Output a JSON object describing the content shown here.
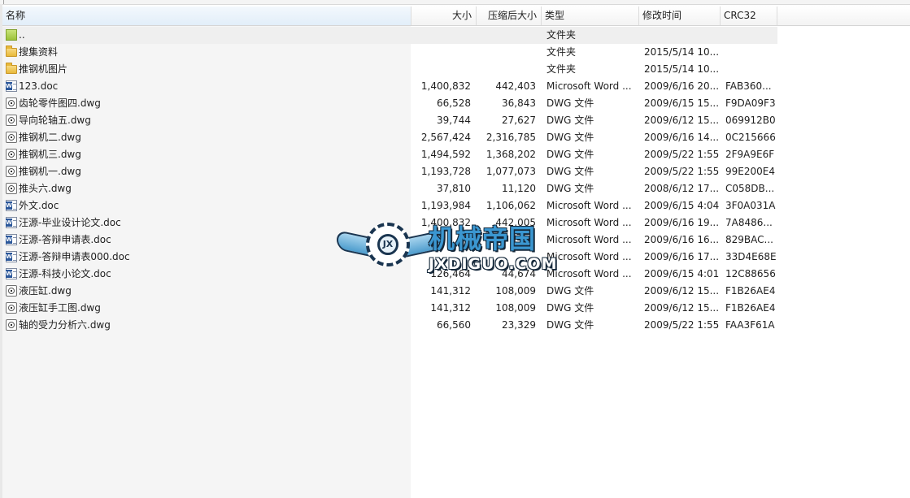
{
  "columns": {
    "name": "名称",
    "size": "大小",
    "compressed": "压缩后大小",
    "type": "类型",
    "modified": "修改时间",
    "crc": "CRC32"
  },
  "rows": [
    {
      "name": "..",
      "size": "",
      "compressed": "",
      "type": "文件夹",
      "modified": "",
      "crc": "",
      "icon": "folder-up-icon"
    },
    {
      "name": "搜集资料",
      "size": "",
      "compressed": "",
      "type": "文件夹",
      "modified": "2015/5/14 10...",
      "crc": "",
      "icon": "folder-icon"
    },
    {
      "name": "推钢机图片",
      "size": "",
      "compressed": "",
      "type": "文件夹",
      "modified": "2015/5/14 10...",
      "crc": "",
      "icon": "folder-icon"
    },
    {
      "name": "123.doc",
      "size": "1,400,832",
      "compressed": "442,403",
      "type": "Microsoft Word ...",
      "modified": "2009/6/16 20...",
      "crc": "FAB360...",
      "icon": "word-doc-icon"
    },
    {
      "name": "齿轮零件图四.dwg",
      "size": "66,528",
      "compressed": "36,843",
      "type": "DWG 文件",
      "modified": "2009/6/15 15...",
      "crc": "F9DA09F3",
      "icon": "dwg-file-icon"
    },
    {
      "name": "导向轮轴五.dwg",
      "size": "39,744",
      "compressed": "27,627",
      "type": "DWG 文件",
      "modified": "2009/6/12 15...",
      "crc": "069912B0",
      "icon": "dwg-file-icon"
    },
    {
      "name": "推钢机二.dwg",
      "size": "2,567,424",
      "compressed": "2,316,785",
      "type": "DWG 文件",
      "modified": "2009/6/16 14...",
      "crc": "0C215666",
      "icon": "dwg-file-icon"
    },
    {
      "name": "推钢机三.dwg",
      "size": "1,494,592",
      "compressed": "1,368,202",
      "type": "DWG 文件",
      "modified": "2009/5/22 1:55",
      "crc": "2F9A9E6F",
      "icon": "dwg-file-icon"
    },
    {
      "name": "推钢机一.dwg",
      "size": "1,193,728",
      "compressed": "1,077,073",
      "type": "DWG 文件",
      "modified": "2009/5/22 1:55",
      "crc": "99E200E4",
      "icon": "dwg-file-icon"
    },
    {
      "name": "推头六.dwg",
      "size": "37,810",
      "compressed": "11,120",
      "type": "DWG 文件",
      "modified": "2008/6/12 17...",
      "crc": "C058DB...",
      "icon": "dwg-file-icon"
    },
    {
      "name": "外文.doc",
      "size": "1,193,984",
      "compressed": "1,106,062",
      "type": "Microsoft Word ...",
      "modified": "2009/6/15 4:04",
      "crc": "3F0A031A",
      "icon": "word-doc-icon"
    },
    {
      "name": "汪源-毕业设计论文.doc",
      "size": "1,400,832",
      "compressed": "442,005",
      "type": "Microsoft Word ...",
      "modified": "2009/6/16 19...",
      "crc": "7A8486...",
      "icon": "word-doc-icon"
    },
    {
      "name": "汪源-答辩申请表.doc",
      "size": "",
      "compressed": "",
      "type": "Microsoft Word ...",
      "modified": "2009/6/16 16...",
      "crc": "829BAC...",
      "icon": "word-doc-icon"
    },
    {
      "name": "汪源-答辩申请表000.doc",
      "size": "",
      "compressed": "",
      "type": "Microsoft Word ...",
      "modified": "2009/6/16 17...",
      "crc": "33D4E68E",
      "icon": "word-doc-icon"
    },
    {
      "name": "汪源-科技小论文.doc",
      "size": "126,464",
      "compressed": "44,674",
      "type": "Microsoft Word ...",
      "modified": "2009/6/15 4:01",
      "crc": "12C88656",
      "icon": "word-doc-icon"
    },
    {
      "name": "液压缸.dwg",
      "size": "141,312",
      "compressed": "108,009",
      "type": "DWG 文件",
      "modified": "2009/6/12 15...",
      "crc": "F1B26AE4",
      "icon": "dwg-file-icon"
    },
    {
      "name": "液压缸手工图.dwg",
      "size": "141,312",
      "compressed": "108,009",
      "type": "DWG 文件",
      "modified": "2009/6/12 15...",
      "crc": "F1B26AE4",
      "icon": "dwg-file-icon"
    },
    {
      "name": "轴的受力分析六.dwg",
      "size": "66,560",
      "compressed": "23,329",
      "type": "DWG 文件",
      "modified": "2009/5/22 1:55",
      "crc": "FAA3F61A",
      "icon": "dwg-file-icon"
    }
  ],
  "watermark": {
    "title": "机械帝国",
    "subtitle": "JXDIGUO.COM",
    "badge": "JX"
  },
  "colors": {
    "selected_row": "#efefef",
    "name_column_bg": "#f5f5f5",
    "watermark_blue": "#3b97d1",
    "watermark_dark": "#15283a"
  }
}
